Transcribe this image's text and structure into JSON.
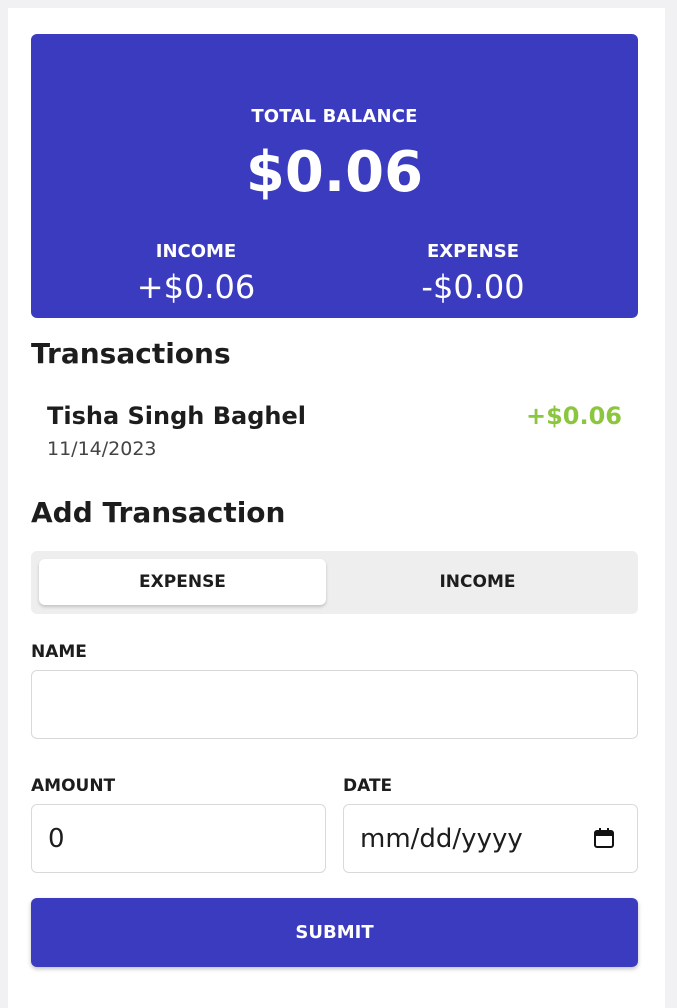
{
  "summary": {
    "total_label": "TOTAL BALANCE",
    "total_value": "$0.06",
    "income_label": "INCOME",
    "income_value": "+$0.06",
    "expense_label": "EXPENSE",
    "expense_value": "-$0.00",
    "accent_color": "#3b3bbf"
  },
  "transactions": {
    "title": "Transactions",
    "items": [
      {
        "name": "Tisha Singh Baghel",
        "date": "11/14/2023",
        "amount": "+$0.06",
        "color": "#8cc63f"
      }
    ]
  },
  "add_transaction": {
    "title": "Add Transaction",
    "toggle": {
      "expense_label": "EXPENSE",
      "income_label": "INCOME",
      "selected": "EXPENSE"
    },
    "name_label": "NAME",
    "name_value": "",
    "amount_label": "AMOUNT",
    "amount_value": "0",
    "date_label": "DATE",
    "date_placeholder": "mm/dd/yyyy",
    "date_icon": "calendar-icon",
    "submit_label": "SUBMIT"
  }
}
